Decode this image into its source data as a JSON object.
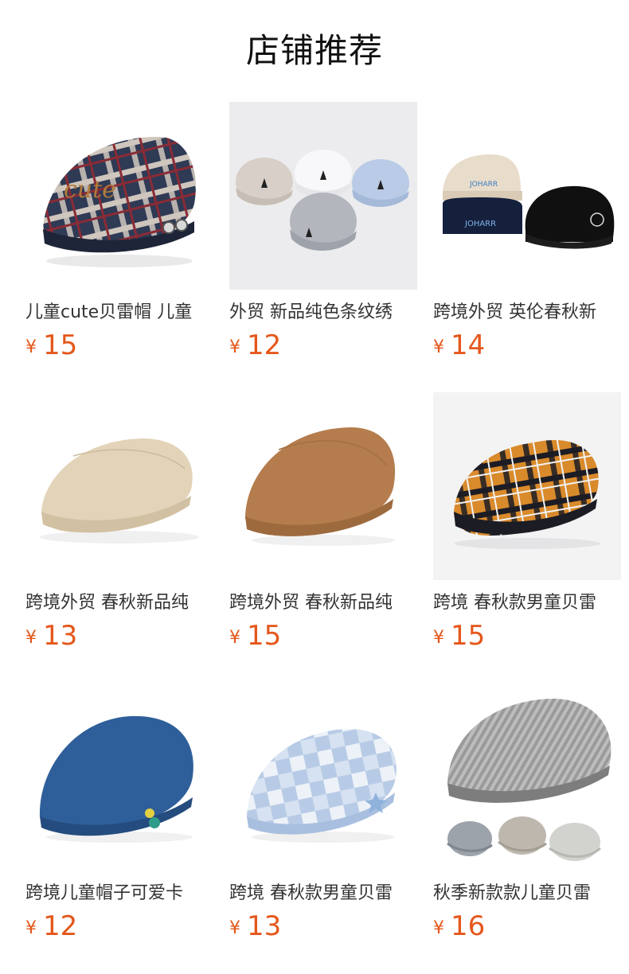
{
  "header": {
    "title": "店铺推荐"
  },
  "colors": {
    "price": "#e4571b",
    "title_text": "#111111",
    "name_text": "#333333"
  },
  "currency_symbol": "¥",
  "products": [
    {
      "name": "儿童cute贝雷帽 儿童",
      "price": "15",
      "image_icon": "plaid-navy-beret-icon"
    },
    {
      "name": "外贸 新品纯色条纹绣",
      "price": "12",
      "image_icon": "striped-caps-group-icon"
    },
    {
      "name": "跨境外贸 英伦春秋新",
      "price": "14",
      "image_icon": "cap-trio-icon"
    },
    {
      "name": "跨境外贸 春秋新品纯",
      "price": "13",
      "image_icon": "beige-beret-icon"
    },
    {
      "name": "跨境外贸 春秋新品纯",
      "price": "15",
      "image_icon": "brown-beret-icon"
    },
    {
      "name": "跨境 春秋款男童贝雷",
      "price": "15",
      "image_icon": "orange-plaid-beret-icon"
    },
    {
      "name": "跨境儿童帽子可爱卡",
      "price": "12",
      "image_icon": "denim-beret-icon"
    },
    {
      "name": "跨境 春秋款男童贝雷",
      "price": "13",
      "image_icon": "blue-check-beret-icon"
    },
    {
      "name": "秋季新款款儿童贝雷",
      "price": "16",
      "image_icon": "grey-tweed-beret-icon"
    }
  ]
}
